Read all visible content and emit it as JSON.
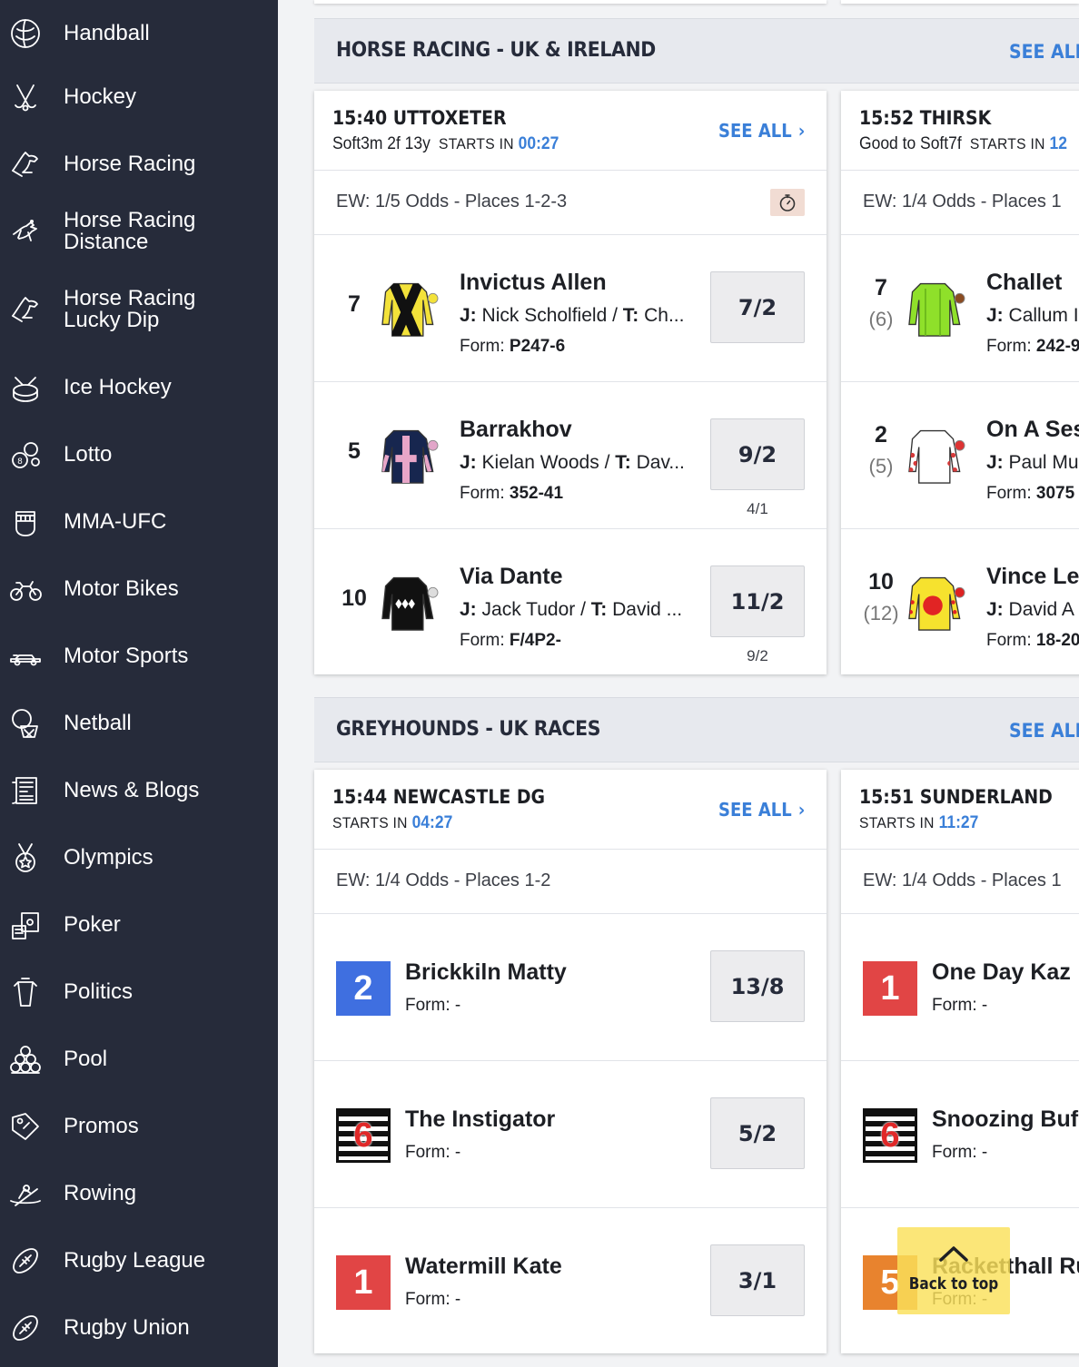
{
  "sidebar": {
    "items": [
      {
        "label": "Handball",
        "icon": "handball-icon"
      },
      {
        "label": "Hockey",
        "icon": "hockey-icon"
      },
      {
        "label": "Horse Racing",
        "icon": "horse-racing-icon"
      },
      {
        "label": "Horse Racing\nDistance",
        "icon": "horse-racing-distance-icon"
      },
      {
        "label": "Horse Racing\nLucky Dip",
        "icon": "horse-racing-lucky-dip-icon"
      },
      {
        "label": "Ice Hockey",
        "icon": "ice-hockey-icon"
      },
      {
        "label": "Lotto",
        "icon": "lotto-icon"
      },
      {
        "label": "MMA-UFC",
        "icon": "mma-fist-icon"
      },
      {
        "label": "Motor Bikes",
        "icon": "motorbike-icon"
      },
      {
        "label": "Motor Sports",
        "icon": "race-car-icon"
      },
      {
        "label": "Netball",
        "icon": "netball-icon"
      },
      {
        "label": "News & Blogs",
        "icon": "news-icon"
      },
      {
        "label": "Olympics",
        "icon": "medal-icon"
      },
      {
        "label": "Poker",
        "icon": "poker-icon"
      },
      {
        "label": "Politics",
        "icon": "podium-icon"
      },
      {
        "label": "Pool",
        "icon": "pool-balls-icon"
      },
      {
        "label": "Promos",
        "icon": "promo-tag-icon"
      },
      {
        "label": "Rowing",
        "icon": "rowing-icon"
      },
      {
        "label": "Rugby League",
        "icon": "rugby-ball-icon"
      },
      {
        "label": "Rugby Union",
        "icon": "rugby-ball-icon"
      }
    ]
  },
  "sections": [
    {
      "title": "HORSE RACING - UK & IRELAND",
      "see_all": "SEE ALL",
      "cards": [
        {
          "time_venue": "15:40 UTTOXETER",
          "going": "Soft3m 2f 13y",
          "starts_label": "STARTS IN",
          "countdown": "00:27",
          "see_all": "SEE ALL",
          "ew": "EW: 1/5 Odds - Places 1-2-3",
          "runners": [
            {
              "num": "7",
              "draw": "",
              "name": "Invictus Allen",
              "j": "Nick Scholfield",
              "t": "Ch...",
              "form": "P247-6",
              "odds": "7/2",
              "prev": "",
              "silk": "silk-yellow-black-cross"
            },
            {
              "num": "5",
              "draw": "",
              "name": "Barrakhov",
              "j": "Kielan Woods",
              "t": "Dav...",
              "form": "352-41",
              "odds": "9/2",
              "prev": "4/1",
              "silk": "silk-navy-pink-cross"
            },
            {
              "num": "10",
              "draw": "",
              "name": "Via Dante",
              "j": "Jack Tudor",
              "t": "David ...",
              "form": "F/4P2-",
              "odds": "11/2",
              "prev": "9/2",
              "silk": "silk-black-white-diamonds"
            }
          ]
        },
        {
          "time_venue": "15:52 THIRSK",
          "going": "Good to Soft7f",
          "starts_label": "STARTS IN",
          "countdown": "12",
          "ew": "EW: 1/4 Odds - Places 1",
          "runners": [
            {
              "num": "7",
              "draw": "(6)",
              "name": "Challet",
              "j": "Callum I",
              "t": "",
              "form": "242-9",
              "silk": "silk-lime-green"
            },
            {
              "num": "2",
              "draw": "(5)",
              "name": "On A Ses",
              "j": "Paul Mu",
              "t": "",
              "form": "3075",
              "silk": "silk-white-red-spots"
            },
            {
              "num": "10",
              "draw": "(12)",
              "name": "Vince Le",
              "j": "David A",
              "t": "",
              "form": "18-20",
              "silk": "silk-yellow-red-disc"
            }
          ]
        }
      ]
    },
    {
      "title": "GREYHOUNDS - UK RACES",
      "see_all": "SEE ALL",
      "cards": [
        {
          "time_venue": "15:44 NEWCASTLE DG",
          "starts_label": "STARTS IN",
          "countdown": "04:27",
          "see_all": "SEE ALL",
          "ew": "EW: 1/4 Odds - Places 1-2",
          "runners": [
            {
              "trap": "2",
              "trap_color": "#3f6fe0",
              "name": "Brickkiln Matty",
              "form": "-",
              "odds": "13/8"
            },
            {
              "trap": "6",
              "trap_color": "striped",
              "name": "The Instigator",
              "form": "-",
              "odds": "5/2"
            },
            {
              "trap": "1",
              "trap_color": "#e14545",
              "name": "Watermill Kate",
              "form": "-",
              "odds": "3/1"
            }
          ]
        },
        {
          "time_venue": "15:51 SUNDERLAND",
          "starts_label": "STARTS IN",
          "countdown": "11:27",
          "ew": "EW: 1/4 Odds - Places 1",
          "runners": [
            {
              "trap": "1",
              "trap_color": "#e14545",
              "name": "One Day Kaz",
              "form": "-"
            },
            {
              "trap": "6",
              "trap_color": "striped",
              "name": "Snoozing Buf",
              "form": "-"
            },
            {
              "trap": "5",
              "trap_color": "#e8832e",
              "name": "Racketthall Ru",
              "form": "-"
            }
          ]
        }
      ]
    }
  ],
  "labels": {
    "j": "J:",
    "t": "T:",
    "form": "Form:"
  },
  "back_to_top": "Back to top",
  "colors": {
    "sidebar_bg": "#262b3a",
    "accent_blue": "#3a7fd8",
    "back_to_top": "#fae05a"
  }
}
